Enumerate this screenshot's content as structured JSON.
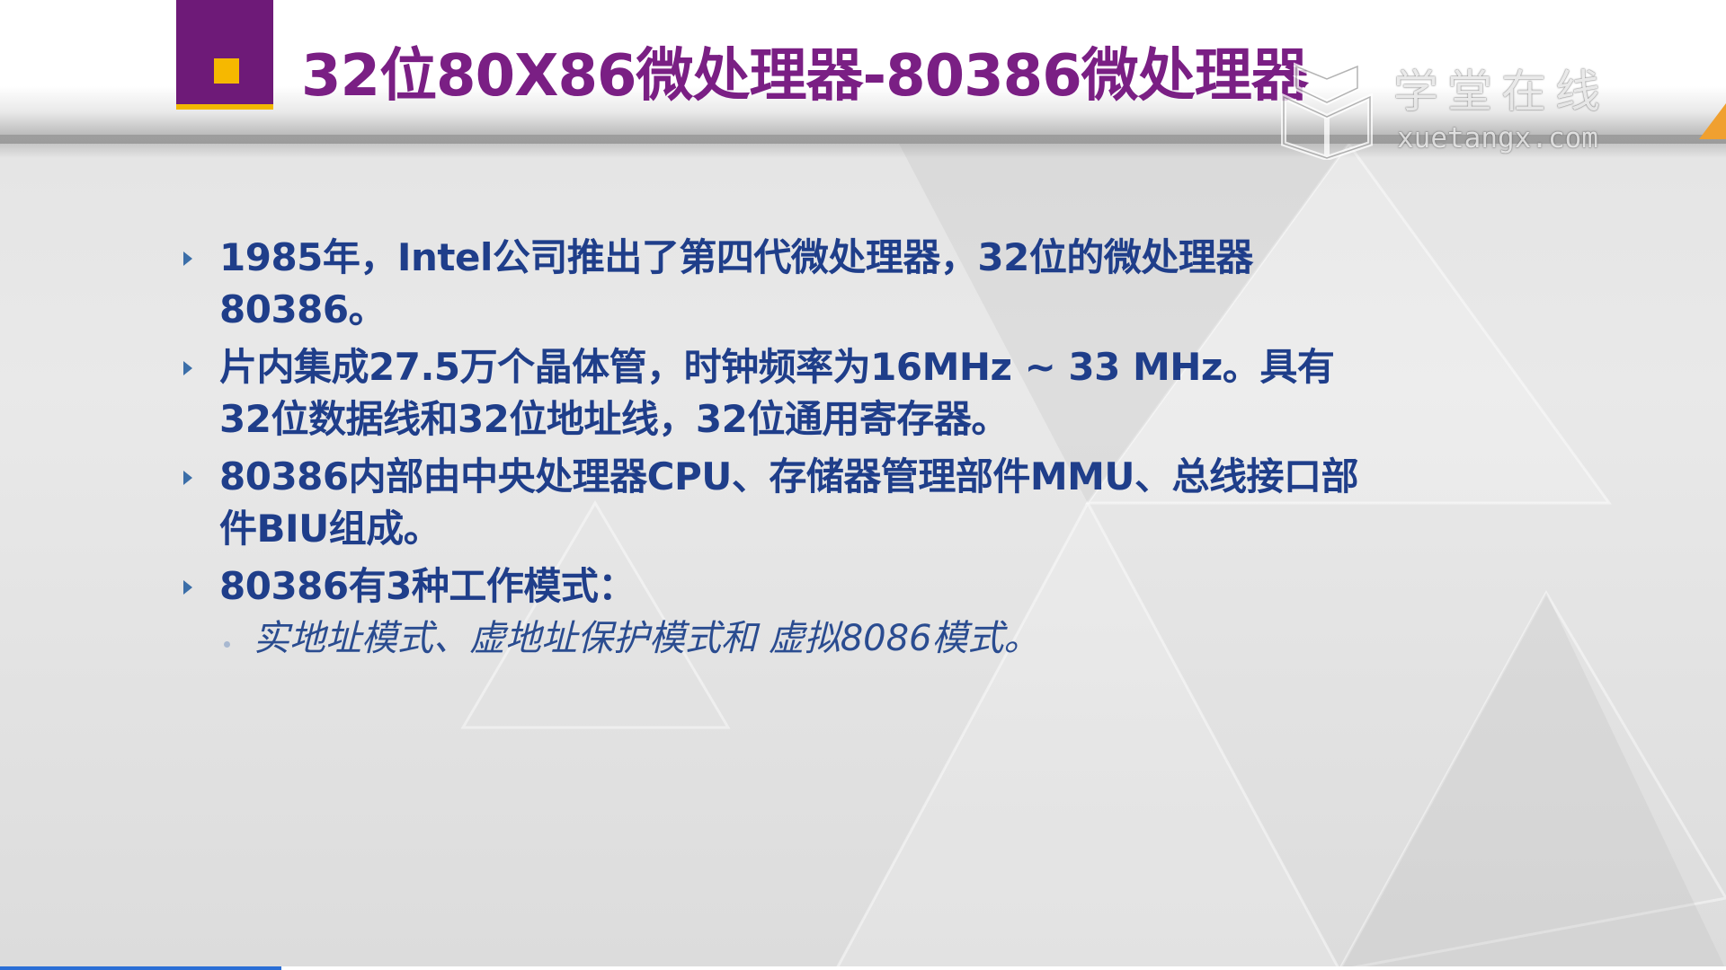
{
  "slide": {
    "title": "32位80X86微处理器-80386微处理器",
    "bullets": [
      {
        "text": "1985年，Intel公司推出了第四代微处理器，32位的微处理器80386。"
      },
      {
        "text": "片内集成27.5万个晶体管，时钟频率为16MHz ~ 33 MHz。具有32位数据线和32位地址线，32位通用寄存器。"
      },
      {
        "text": "80386内部由中央处理器CPU、存储器管理部件MMU、总线接口部件BIU组成。"
      },
      {
        "text": "80386有3种工作模式：",
        "sub": [
          {
            "text": "实地址模式、虚地址保护模式和 虚拟8086模式。"
          }
        ]
      }
    ]
  },
  "watermark": {
    "cn": "学堂在线",
    "en": "xuetangx.com",
    "icon": "book-logo-icon"
  },
  "colors": {
    "title": "#7a1f84",
    "marker": "#6e1a78",
    "marker_square": "#f6b800",
    "body_text": "#1f3e8a",
    "bullet_arrow": "#3b6ea8",
    "progress": "#2a6fd6",
    "corner_accent": "#f0a030"
  },
  "playback": {
    "progress_fraction": 0.163
  }
}
